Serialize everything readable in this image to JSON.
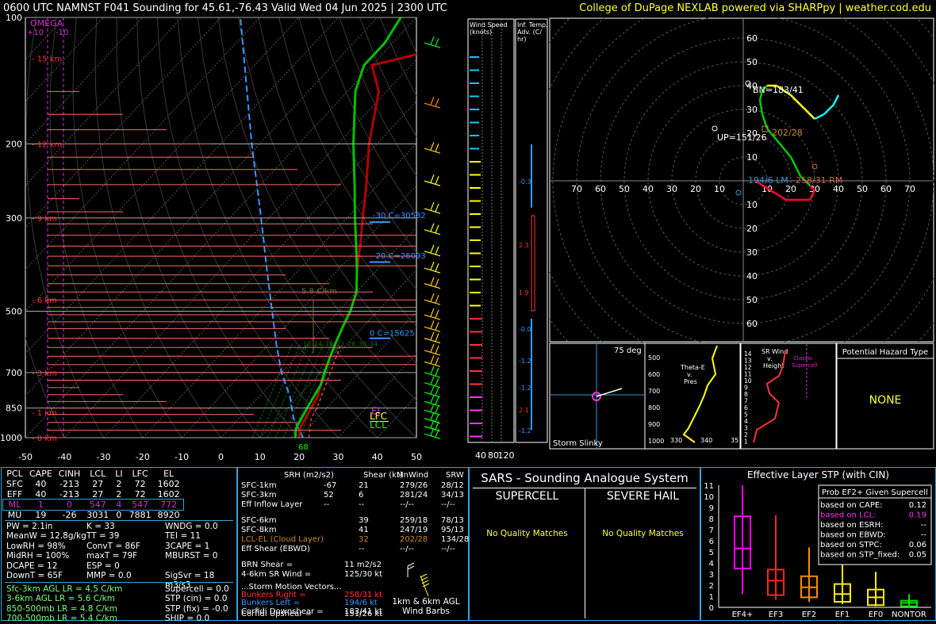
{
  "header": {
    "title": "0600 UTC NAMNST F041 Sounding for 45.61,-76.43 Valid  Wed 04 Jun 2025 | 2300 UTC",
    "credit": "College of DuPage NEXLAB powered via SHARPpy | weather.cod.edu"
  },
  "colors": {
    "temperature": "#b30000",
    "dewpoint": "#00c000",
    "wetbulb": "#00ffff",
    "virtual_temp_parcel": "#ff3333",
    "isotherms": "#808080",
    "dry_adiabats": "#606060",
    "hodo_low": "#ff0033",
    "hodo_mid": "#00cc00",
    "hodo_high": "#ffff00",
    "hodo_top": "#00ffff",
    "panel_border": "#3aa0d8"
  },
  "skewt": {
    "pressure_ticks": [
      "100",
      "200",
      "300",
      "500",
      "700",
      "850",
      "1000"
    ],
    "temp_ticks": [
      "-50",
      "-40",
      "-30",
      "-20",
      "-10",
      "0",
      "10",
      "20",
      "30",
      "40",
      "50"
    ],
    "height_labels": [
      "15 km",
      "12 km",
      "9 km",
      "6 km",
      "3 km",
      "1 km",
      "0 km"
    ],
    "omega_title": "OMEGA",
    "omega_ticks": [
      "+10",
      "-10"
    ],
    "annotations": {
      "hgz_top": "-30 C=30582",
      "hgz_mid": "-20 C=26093",
      "freezing": "0 C=15625",
      "lapse_rate": "5.8 C/km",
      "el": "EL",
      "lfc": "LFC",
      "lcl": "LCL",
      "sfc_temp": "68",
      "mixing_ratio_labels": [
        "10",
        "14",
        "18",
        "22",
        "26",
        "30",
        "34"
      ]
    }
  },
  "chart_data": [
    {
      "type": "line",
      "title": "",
      "xlabel": "",
      "ylabel": "",
      "ylim": [
        1000,
        100
      ],
      "xlim": [
        -50,
        50
      ],
      "series": [
        {
          "name": "Temperature",
          "pressure": [
            1000,
            950,
            900,
            850,
            800,
            750,
            700,
            650,
            600,
            550,
            500,
            450,
            400,
            350,
            300,
            250,
            200,
            150,
            130,
            115,
            100
          ],
          "values": [
            20,
            18,
            17,
            16,
            15,
            13,
            11,
            9,
            7,
            5,
            3,
            0,
            -5,
            -10,
            -16,
            -23,
            -32,
            -42,
            -50,
            -32,
            -28
          ]
        },
        {
          "name": "Dewpoint",
          "pressure": [
            1000,
            950,
            900,
            850,
            800,
            750,
            700,
            650,
            600,
            550,
            500,
            450,
            400,
            350,
            300,
            250,
            200,
            150,
            130,
            115,
            100
          ],
          "values": [
            19,
            17,
            16,
            15,
            14,
            13,
            11,
            9,
            7,
            5,
            3,
            0,
            -5,
            -11,
            -18,
            -26,
            -36,
            -48,
            -52,
            -52,
            -54
          ]
        }
      ]
    },
    {
      "type": "line",
      "title": "",
      "xlabel": "",
      "ylabel": "",
      "xlim": [
        -70,
        70
      ],
      "ylim": [
        -65,
        65
      ],
      "series": [
        {
          "name": "",
          "x": [
            5,
            18,
            28,
            30,
            28,
            24,
            20,
            15,
            10,
            8,
            7,
            8,
            10,
            14,
            20,
            26,
            30,
            34,
            38,
            40
          ],
          "y": [
            0,
            -8,
            -8,
            -4,
            -2,
            2,
            10,
            16,
            22,
            28,
            34,
            38,
            40,
            40,
            36,
            30,
            26,
            28,
            32,
            36
          ]
        }
      ],
      "x_ticks": [
        "70",
        "60",
        "50",
        "40",
        "30",
        "20",
        "10",
        "10",
        "20",
        "30",
        "40",
        "50",
        "60",
        "70"
      ],
      "y_ticks": [
        "60",
        "50",
        "40",
        "30",
        "20",
        "10",
        "10",
        "20",
        "30",
        "40",
        "50",
        "60"
      ],
      "labels": {
        "bn": "BN=183/41",
        "mean": "202/28",
        "up": "UP=151/26",
        "lm": "194/6 LM",
        "rm": "258/31 RM"
      }
    },
    {
      "type": "bar",
      "title": "Effective Layer STP (with CIN)",
      "categories": [
        "EF4+",
        "EF3",
        "EF2",
        "EF1",
        "EF0",
        "NONTOR"
      ],
      "values": [
        5.3,
        2.4,
        1.8,
        1.2,
        0.9,
        0.4
      ],
      "ylim": [
        0,
        11
      ],
      "y_ticks": [
        "0",
        "1",
        "2",
        "3",
        "4",
        "5",
        "6",
        "7",
        "8",
        "9",
        "10",
        "11"
      ]
    }
  ],
  "wind_panel": {
    "speed_title": "Wind Speed (knots)",
    "speed_ticks": [
      "40",
      "80",
      "120"
    ],
    "tadv_title": "Inf. Temp. Adv. (C/ hr)",
    "tadv_labels": [
      "-0.3",
      "2.3",
      "1.9",
      "-0.0",
      "-1.2",
      "-1.2",
      "2.1",
      "-1.2"
    ]
  },
  "slinky": {
    "angle": "75 deg",
    "label": "Storm Slinky"
  },
  "thetae": {
    "title": "Theta-E v. Pres",
    "ticks_y": [
      "500",
      "600",
      "700",
      "800",
      "900",
      "1000"
    ],
    "ticks_x": [
      "330",
      "340",
      "35"
    ]
  },
  "srwind": {
    "title": "SR Wind v. Height",
    "classic": "Classic Supercell",
    "ticks_y": [
      "14",
      "13",
      "12",
      "11",
      "10",
      "9",
      "8",
      "7",
      "6",
      "5",
      "4",
      "3",
      "2",
      "1"
    ]
  },
  "hazard": {
    "title": "Potential Hazard Type",
    "value": "NONE"
  },
  "parcels": {
    "headers": [
      "PCL",
      "CAPE",
      "CINH",
      "LCL",
      "LI",
      "LFC",
      "EL"
    ],
    "rows": [
      [
        "SFC",
        "40",
        "-213",
        "27",
        "2",
        "72",
        "1602"
      ],
      [
        "EFF",
        "40",
        "-213",
        "27",
        "2",
        "72",
        "1602"
      ],
      [
        "ML",
        "1",
        "0",
        "547",
        "4",
        "547",
        "772"
      ],
      [
        "MU",
        "19",
        "-26",
        "3031",
        "0",
        "7881",
        "8920"
      ]
    ]
  },
  "indices": {
    "col1": [
      "PW = 2.1in",
      "MeanW = 12.8g/kg",
      "LowRH = 98%",
      "MidRH = 100%",
      "DCAPE = 12",
      "DownT = 65F"
    ],
    "col2": [
      "K = 33",
      "TT = 39",
      "ConvT = 86F",
      "maxT = 79F",
      "ESP = 0",
      "MMP = 0.0"
    ],
    "col3": [
      "WNDG = 0.0",
      "TEI = 11",
      "3CAPE = 1",
      "MBURST = 0",
      "",
      "SigSvr = 18 m3/s3"
    ]
  },
  "lapse_rates": [
    "Sfc-3km AGL LR = 4.5 C/km",
    "3-6km AGL LR = 5.6 C/km",
    "850-500mb LR = 4.8 C/km",
    "700-500mb LR = 5.4 C/km"
  ],
  "composites": [
    "Supercell = 0.0",
    "STP (cin) = 0.0",
    "STP (fix) = -0.0",
    "SHIP = 0.0"
  ],
  "kinematics": {
    "headers": [
      "SRH (m2/s2)",
      "Shear (kt)",
      "MnWind",
      "SRW"
    ],
    "rows": [
      [
        "SFC-1km",
        "-67",
        "21",
        "279/26",
        "28/12"
      ],
      [
        "SFC-3km",
        "52",
        "6",
        "281/24",
        "34/13"
      ],
      [
        "Eff Inflow Layer",
        "--",
        "--",
        "--/--",
        "--/--"
      ],
      [
        "SFC-6km",
        "39",
        "259/18",
        "78/13",
        ""
      ],
      [
        "SFC-8km",
        "41",
        "247/19",
        "95/13",
        ""
      ],
      [
        "LCL-EL (Cloud Layer)",
        "32",
        "202/28",
        "134/28",
        ""
      ],
      [
        "Eff Shear (EBWD)",
        "--",
        "--/--",
        "--/--",
        ""
      ]
    ],
    "brn_shear": "BRN Shear =",
    "brn_val": "11 m2/s2",
    "sr_wind": "4-6km SR Wind =",
    "sr_val": "125/30 kt",
    "storm_motion_title": "...Storm Motion Vectors...",
    "bunkers_right": "Bunkers Right =",
    "bunkers_right_val": "258/31 kt",
    "bunkers_left": "Bunkers Left =",
    "bunkers_left_val": "194/6 kt",
    "corfidi_down": "Corfidi Downshear =",
    "corfidi_down_val": "183/41 kt",
    "corfidi_up": "Corfidi Upshear =",
    "corfidi_up_val": "151/26 kt",
    "barbs_label": "1km & 6km AGL Wind Barbs"
  },
  "sars": {
    "title": "SARS - Sounding Analogue System",
    "supercell": "SUPERCELL",
    "hail": "SEVERE HAIL",
    "supercell_result": "No Quality Matches",
    "hail_result": "No Quality Matches"
  },
  "stp_probs": {
    "title": "Prob EF2+ Given Supercell",
    "rows": [
      [
        "based on CAPE:",
        "0.12"
      ],
      [
        "based on LCL:",
        "0.19"
      ],
      [
        "based on ESRH:",
        "--"
      ],
      [
        "based on EBWD:",
        "--"
      ],
      [
        "based on STPC:",
        "0.06"
      ],
      [
        "based on STP_fixed:",
        "0.05"
      ]
    ]
  }
}
